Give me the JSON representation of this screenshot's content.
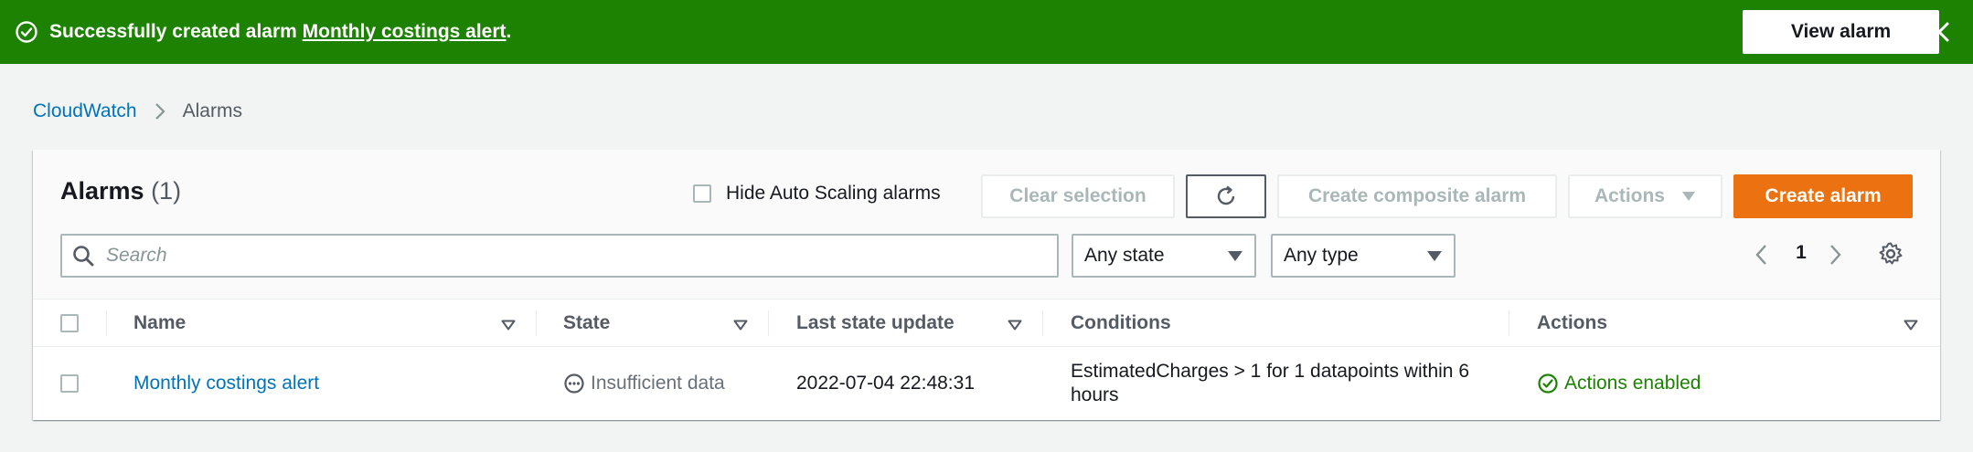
{
  "flash": {
    "prefix": "Successfully created alarm ",
    "alarm_link": "Monthly costings alert",
    "suffix": ".",
    "view_button": "View alarm"
  },
  "breadcrumb": {
    "root": "CloudWatch",
    "current": "Alarms"
  },
  "header": {
    "title": "Alarms",
    "count": "(1)",
    "hide_autoscaling_label": "Hide Auto Scaling alarms",
    "clear_selection": "Clear selection",
    "create_composite": "Create composite alarm",
    "actions": "Actions",
    "create_alarm": "Create alarm"
  },
  "filters": {
    "search_placeholder": "Search",
    "state_select": "Any state",
    "type_select": "Any type",
    "page": "1"
  },
  "table": {
    "columns": [
      "Name",
      "State",
      "Last state update",
      "Conditions",
      "Actions"
    ],
    "rows": [
      {
        "name": "Monthly costings alert",
        "state": "Insufficient data",
        "last_update": "2022-07-04 22:48:31",
        "conditions": "EstimatedCharges > 1 for 1 datapoints within 6 hours",
        "actions": "Actions enabled"
      }
    ]
  },
  "colors": {
    "success": "#1d8102",
    "link": "#0073bb",
    "primary": "#ec7211"
  }
}
